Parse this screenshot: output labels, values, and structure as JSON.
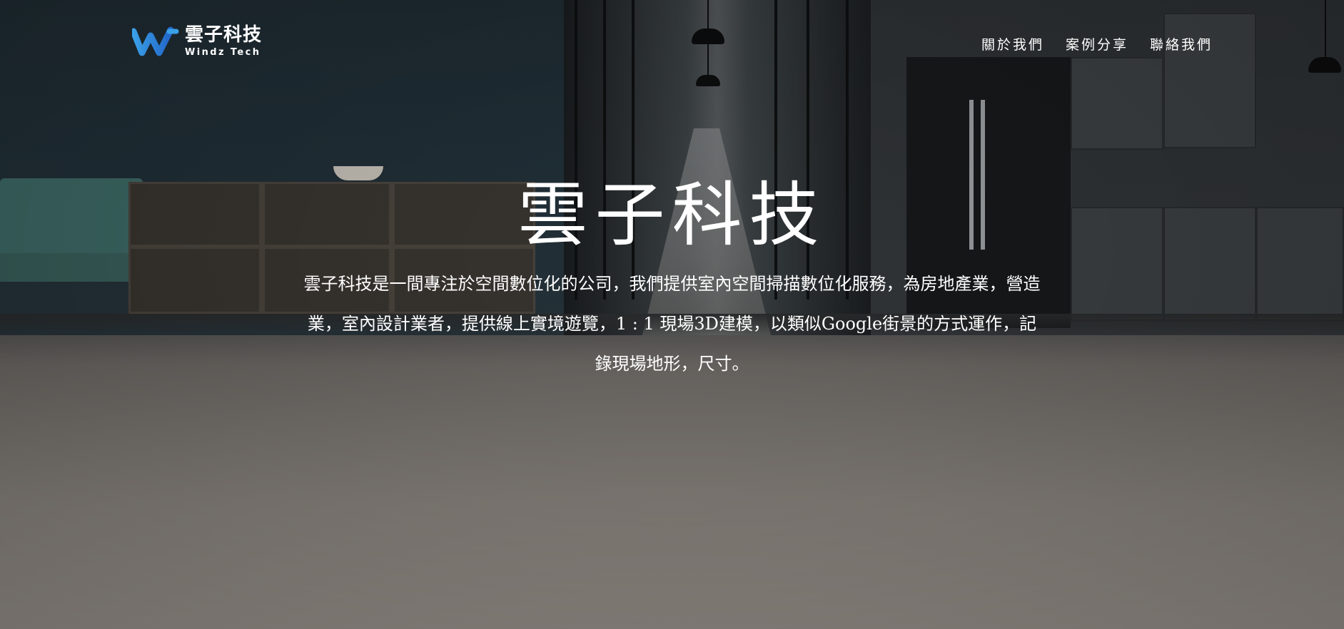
{
  "brand": {
    "name": "雲子科技",
    "tagline": "Windz Tech",
    "logo_color": "#2a8fd6"
  },
  "nav": {
    "items": [
      {
        "label": "關於我們"
      },
      {
        "label": "案例分享"
      },
      {
        "label": "聯絡我們"
      }
    ]
  },
  "hero": {
    "title": "雲子科技",
    "description": "雲子科技是一間專注於空間數位化的公司，我們提供室內空間掃描數位化服務，為房地產業，營造業，室內設計業者，提供線上實境遊覽，1 : 1 現場3D建模，以類似Google街景的方式運作，記錄現場地形，尺寸。"
  }
}
